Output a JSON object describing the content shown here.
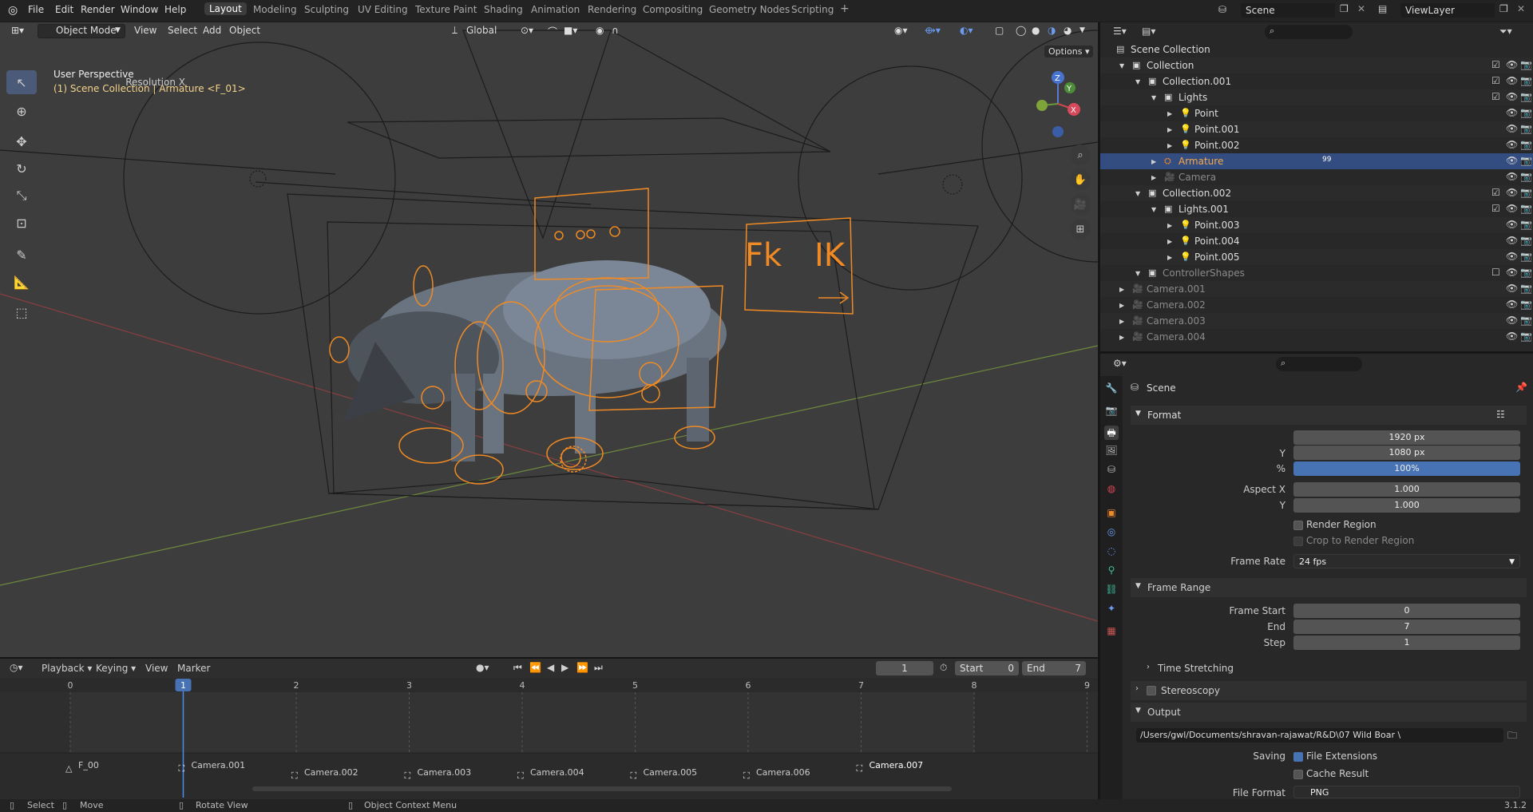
{
  "topbar": {
    "menus": [
      "File",
      "Edit",
      "Render",
      "Window",
      "Help"
    ],
    "workspaces": [
      "Layout",
      "Modeling",
      "Sculpting",
      "UV Editing",
      "Texture Paint",
      "Shading",
      "Animation",
      "Rendering",
      "Compositing",
      "Geometry Nodes",
      "Scripting"
    ],
    "active_workspace": "Layout",
    "add_tab": "+",
    "scene": "Scene",
    "view_layer": "ViewLayer"
  },
  "viewport": {
    "mode": "Object Mode",
    "menus": [
      "View",
      "Select",
      "Add",
      "Object"
    ],
    "transform": "Global",
    "options": "Options",
    "view_name": "User Perspective",
    "context": "(1) Scene Collection | Armature <F_01>",
    "gizmo": {
      "x": "X",
      "y": "Y",
      "z": "Z"
    },
    "rig_labels": {
      "fk": "Fk",
      "ik": "IK"
    }
  },
  "timeline": {
    "menus": [
      "Playback",
      "Keying",
      "View",
      "Marker"
    ],
    "current_frame": "1",
    "start_label": "Start",
    "start": "0",
    "end_label": "End",
    "end": "7",
    "ticks": [
      "0",
      "1",
      "2",
      "3",
      "4",
      "5",
      "6",
      "7",
      "8",
      "9"
    ],
    "markers": [
      "F_00",
      "Camera.001",
      "Camera.002",
      "Camera.003",
      "Camera.004",
      "Camera.005",
      "Camera.006",
      "Camera.007"
    ]
  },
  "outliner": {
    "rows": [
      {
        "name": "Scene Collection",
        "depth": 0,
        "type": "scene"
      },
      {
        "name": "Collection",
        "depth": 1,
        "type": "coll"
      },
      {
        "name": "Collection.001",
        "depth": 2,
        "type": "coll"
      },
      {
        "name": "Lights",
        "depth": 3,
        "type": "coll"
      },
      {
        "name": "Point",
        "depth": 4,
        "type": "light"
      },
      {
        "name": "Point.001",
        "depth": 4,
        "type": "light"
      },
      {
        "name": "Point.002",
        "depth": 4,
        "type": "light"
      },
      {
        "name": "Armature",
        "depth": 3,
        "type": "armature",
        "badge": "99"
      },
      {
        "name": "Camera",
        "depth": 3,
        "type": "camera"
      },
      {
        "name": "Collection.002",
        "depth": 2,
        "type": "coll"
      },
      {
        "name": "Lights.001",
        "depth": 3,
        "type": "coll"
      },
      {
        "name": "Point.003",
        "depth": 4,
        "type": "light"
      },
      {
        "name": "Point.004",
        "depth": 4,
        "type": "light"
      },
      {
        "name": "Point.005",
        "depth": 4,
        "type": "light"
      },
      {
        "name": "ControllerShapes",
        "depth": 2,
        "type": "coll"
      },
      {
        "name": "Camera.001",
        "depth": 1,
        "type": "camera"
      },
      {
        "name": "Camera.002",
        "depth": 1,
        "type": "camera"
      },
      {
        "name": "Camera.003",
        "depth": 1,
        "type": "camera"
      },
      {
        "name": "Camera.004",
        "depth": 1,
        "type": "camera"
      }
    ]
  },
  "properties": {
    "context": "Scene",
    "format": {
      "title": "Format",
      "res_x_label": "Resolution X",
      "res_x": "1920 px",
      "res_y_label": "Y",
      "res_y": "1080 px",
      "pct_label": "%",
      "pct": "100%",
      "aspect_x_label": "Aspect X",
      "aspect_x": "1.000",
      "aspect_y_label": "Y",
      "aspect_y": "1.000",
      "render_region": "Render Region",
      "crop": "Crop to Render Region",
      "fps_label": "Frame Rate",
      "fps": "24 fps"
    },
    "frame_range": {
      "title": "Frame Range",
      "start_label": "Frame Start",
      "start": "0",
      "end_label": "End",
      "end": "7",
      "step_label": "Step",
      "step": "1",
      "time_stretching": "Time Stretching"
    },
    "stereoscopy": "Stereoscopy",
    "output": {
      "title": "Output",
      "path": "/Users/gwl/Documents/shravan-rajawat/R&D\\07 Wild Boar \\",
      "saving_label": "Saving",
      "file_ext": "File Extensions",
      "cache": "Cache Result",
      "format_label": "File Format",
      "format": "PNG"
    }
  },
  "status": {
    "select": "Select",
    "move": "Move",
    "rotate": "Rotate View",
    "context_menu": "Object Context Menu",
    "version": "3.1.2"
  },
  "colors": {
    "accent": "#4772b3",
    "selection": "#334d80",
    "rig": "#f08a24",
    "header": "#232323"
  }
}
